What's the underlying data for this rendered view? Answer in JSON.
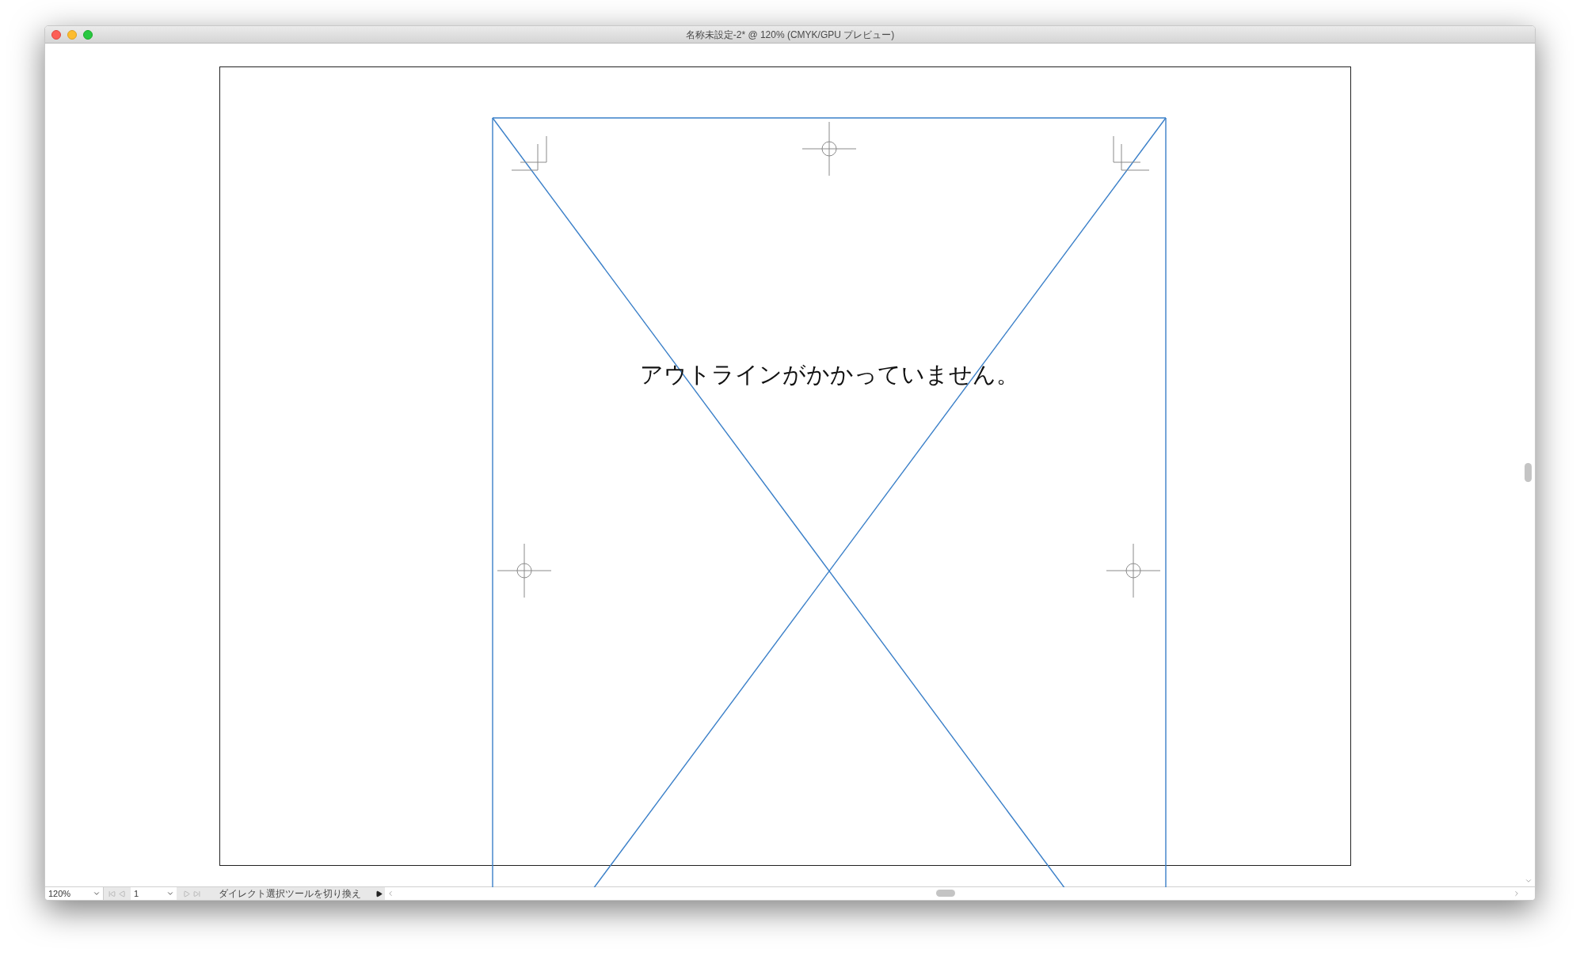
{
  "window": {
    "title": "名称未設定-2* @ 120% (CMYK/GPU プレビュー)"
  },
  "canvas": {
    "text": "アウトラインがかかっていません。"
  },
  "status_bar": {
    "zoom": "120%",
    "page": "1",
    "status": "ダイレクト選択ツールを切り換え"
  }
}
